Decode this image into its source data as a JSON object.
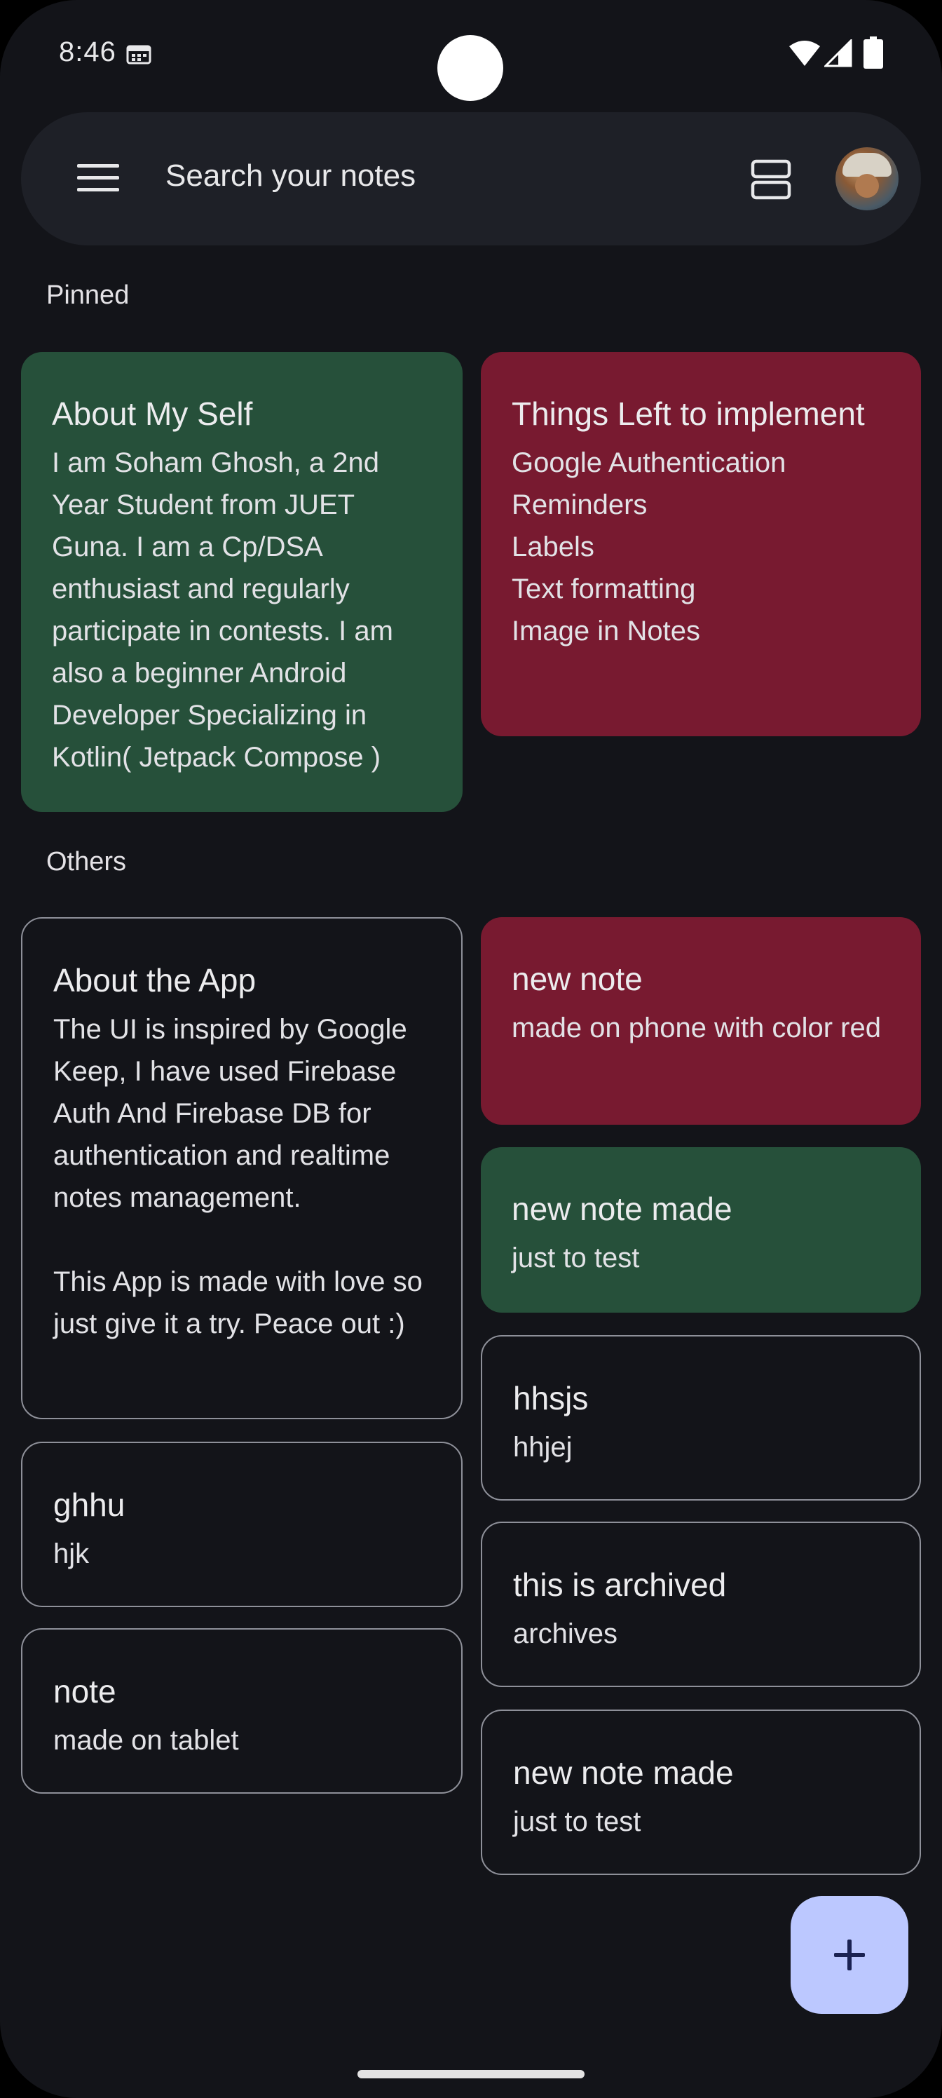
{
  "status_bar": {
    "time": "8:46"
  },
  "search": {
    "placeholder": "Search your notes"
  },
  "sections": {
    "pinned": "Pinned",
    "others": "Others"
  },
  "colors": {
    "green": "#26503a",
    "red": "#781a30",
    "outline": "#8e9099",
    "fab": "#bcc8ff",
    "background": "#131419"
  },
  "pinned": [
    {
      "title": "About My Self",
      "body": "I am Soham Ghosh, a 2nd Year Student from JUET Guna. I am a Cp/DSA enthusiast and regularly participate in contests. I am also a beginner Android Developer Specializing in Kotlin( Jetpack Compose )",
      "color": "green"
    },
    {
      "title": "Things Left to implement",
      "body": "Google Authentication\nReminders\nLabels\nText formatting\nImage in Notes",
      "color": "red"
    }
  ],
  "others": [
    {
      "title": "About the App",
      "body": "The UI is inspired by Google Keep, I have used Firebase Auth And Firebase DB for authentication and realtime notes management.\n\nThis App is made with love so just give it a try. Peace out :)",
      "color": "none"
    },
    {
      "title": "new note",
      "body": "made on phone with color red",
      "color": "red"
    },
    {
      "title": "new note made",
      "body": "just to test",
      "color": "green"
    },
    {
      "title": "ghhu",
      "body": "hjk",
      "color": "none"
    },
    {
      "title": "hhsjs",
      "body": "hhjej",
      "color": "none"
    },
    {
      "title": "note",
      "body": "made on tablet",
      "color": "none"
    },
    {
      "title": "this is archived",
      "body": "archives",
      "color": "none"
    },
    {
      "title": "new note made",
      "body": "just to test",
      "color": "none"
    }
  ],
  "icons": {
    "menu": "menu-icon",
    "view_toggle": "list-view-icon",
    "avatar": "avatar",
    "fab": "plus-icon"
  }
}
